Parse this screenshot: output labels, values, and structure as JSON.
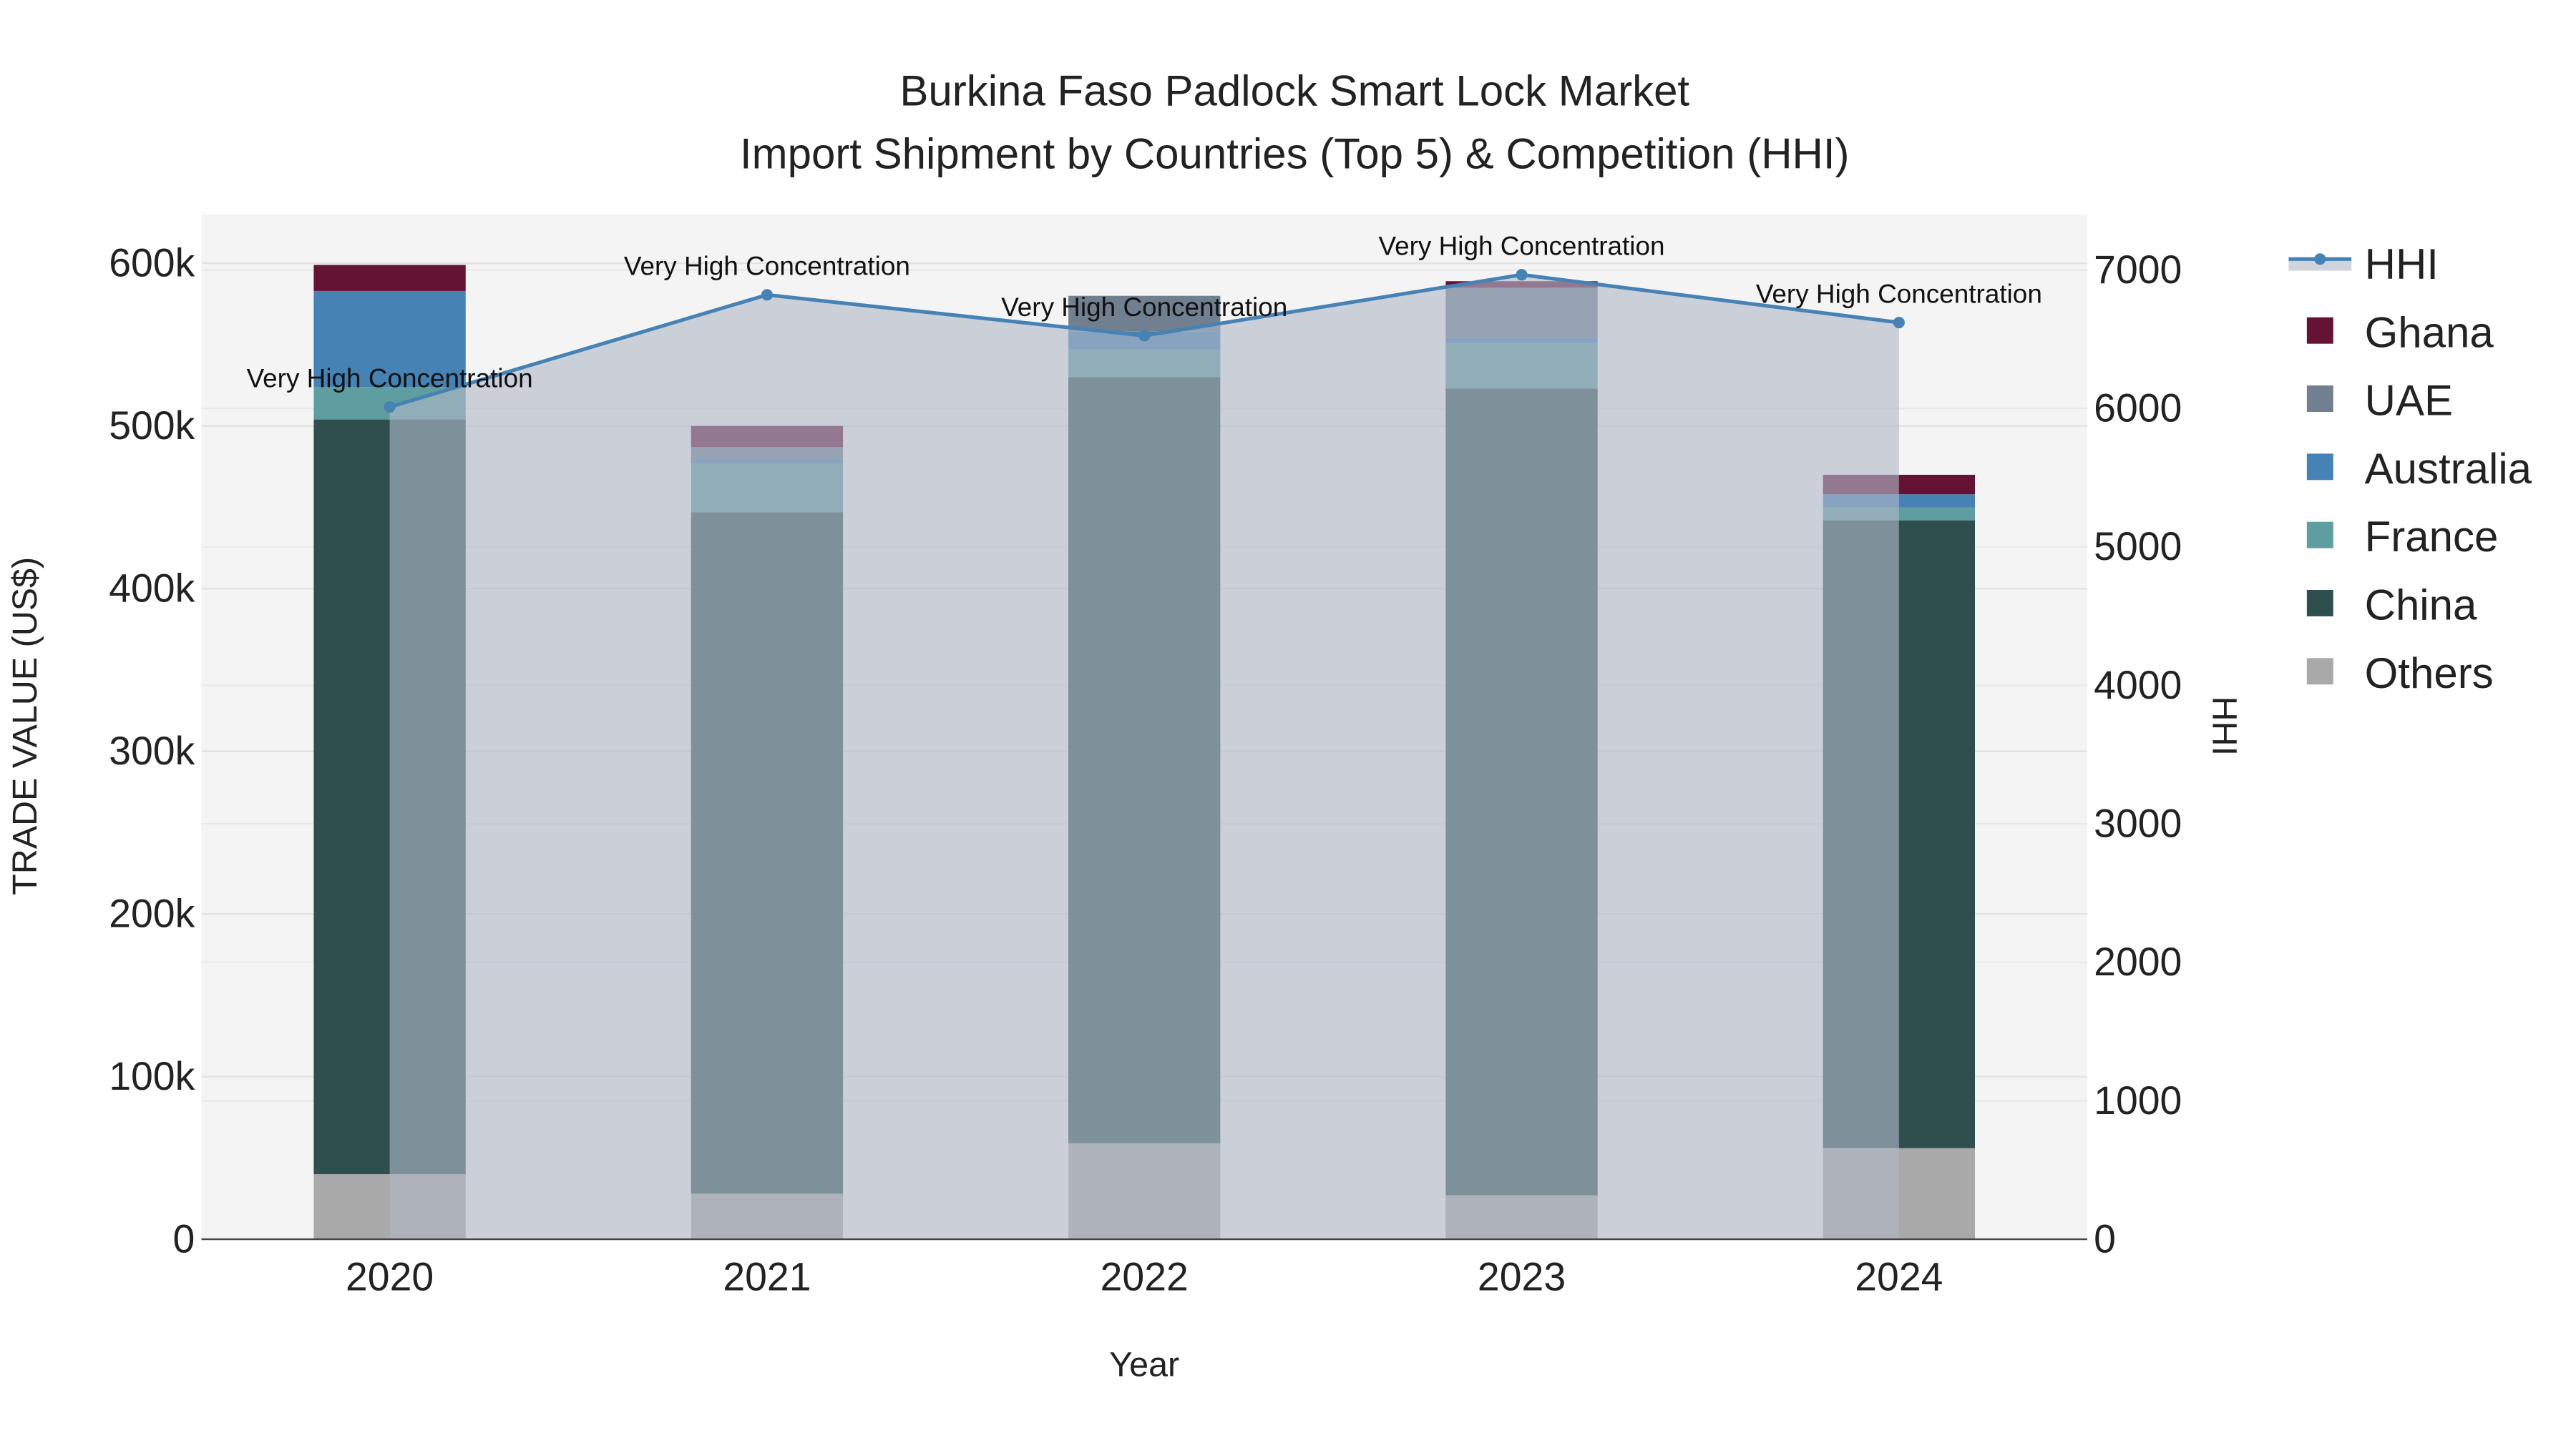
{
  "chart_data": {
    "type": "bar",
    "title": "Burkina Faso Padlock Smart Lock Market",
    "subtitle": "Import Shipment by Countries (Top 5) & Competition (HHI)",
    "xlabel": "Year",
    "ylabel": "TRADE VALUE (US$)",
    "y2label": "HHI",
    "categories": [
      "2020",
      "2021",
      "2022",
      "2023",
      "2024"
    ],
    "ylim": [
      0,
      630000
    ],
    "y2lim": [
      0,
      7400
    ],
    "yticks": [
      0,
      100000,
      200000,
      300000,
      400000,
      500000,
      600000
    ],
    "ytick_labels": [
      "0",
      "100k",
      "200k",
      "300k",
      "400k",
      "500k",
      "600k"
    ],
    "y2ticks": [
      0,
      1000,
      2000,
      3000,
      4000,
      5000,
      6000,
      7000
    ],
    "y2tick_labels": [
      "0",
      "1000",
      "2000",
      "3000",
      "4000",
      "5000",
      "6000",
      "7000"
    ],
    "series": [
      {
        "name": "Others",
        "color": "#A9A9A9",
        "values": [
          40000,
          28000,
          59000,
          27000,
          56000
        ]
      },
      {
        "name": "China",
        "color": "#2F4F4F",
        "values": [
          464000,
          419000,
          471000,
          496000,
          386000
        ]
      },
      {
        "name": "France",
        "color": "#5F9EA0",
        "values": [
          20000,
          30000,
          17000,
          28000,
          8000
        ]
      },
      {
        "name": "Australia",
        "color": "#4682B4",
        "values": [
          59000,
          2000,
          11000,
          3000,
          8000
        ]
      },
      {
        "name": "UAE",
        "color": "#708090",
        "values": [
          0,
          8000,
          22000,
          31000,
          0
        ]
      },
      {
        "name": "Ghana",
        "color": "#641335",
        "values": [
          16000,
          13000,
          0,
          4000,
          12000
        ]
      }
    ],
    "hhi": {
      "name": "HHI",
      "color": "#4682B4",
      "values": [
        6010,
        6820,
        6525,
        6965,
        6620
      ],
      "annotations": [
        "Very High Concentration",
        "Very High Concentration",
        "Very High Concentration",
        "Very High Concentration",
        "Very High Concentration"
      ]
    },
    "legend_order": [
      "HHI",
      "Ghana",
      "UAE",
      "Australia",
      "France",
      "China",
      "Others"
    ],
    "legend_position": "right",
    "grid": true
  }
}
